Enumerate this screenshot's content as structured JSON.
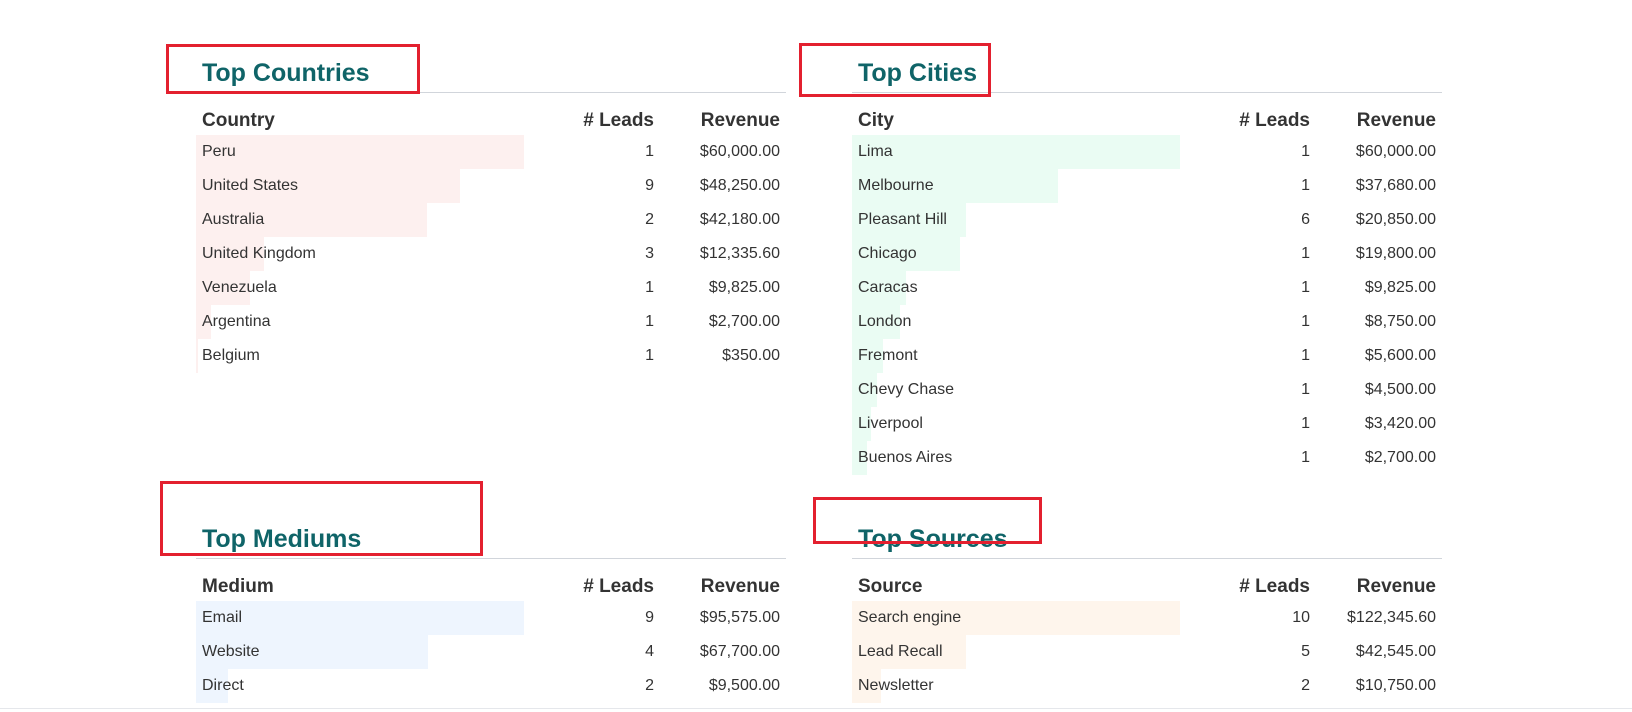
{
  "sections": [
    {
      "id": "countries",
      "title": "Top Countries",
      "headers": [
        "Country",
        "# Leads",
        "Revenue"
      ],
      "bar_color": "#fdf0ef",
      "rows": [
        {
          "label": "Peru",
          "leads": "1",
          "revenue": "$60,000.00",
          "share": 1.0
        },
        {
          "label": "United States",
          "leads": "9",
          "revenue": "$48,250.00",
          "share": 0.804
        },
        {
          "label": "Australia",
          "leads": "2",
          "revenue": "$42,180.00",
          "share": 0.703
        },
        {
          "label": "United Kingdom",
          "leads": "3",
          "revenue": "$12,335.60",
          "share": 0.206
        },
        {
          "label": "Venezuela",
          "leads": "1",
          "revenue": "$9,825.00",
          "share": 0.164
        },
        {
          "label": "Argentina",
          "leads": "1",
          "revenue": "$2,700.00",
          "share": 0.045
        },
        {
          "label": "Belgium",
          "leads": "1",
          "revenue": "$350.00",
          "share": 0.006
        }
      ]
    },
    {
      "id": "cities",
      "title": "Top Cities",
      "headers": [
        "City",
        "# Leads",
        "Revenue"
      ],
      "bar_color": "#eafcf3",
      "rows": [
        {
          "label": "Lima",
          "leads": "1",
          "revenue": "$60,000.00",
          "share": 1.0
        },
        {
          "label": "Melbourne",
          "leads": "1",
          "revenue": "$37,680.00",
          "share": 0.628
        },
        {
          "label": "Pleasant Hill",
          "leads": "6",
          "revenue": "$20,850.00",
          "share": 0.348
        },
        {
          "label": "Chicago",
          "leads": "1",
          "revenue": "$19,800.00",
          "share": 0.33
        },
        {
          "label": "Caracas",
          "leads": "1",
          "revenue": "$9,825.00",
          "share": 0.164
        },
        {
          "label": "London",
          "leads": "1",
          "revenue": "$8,750.00",
          "share": 0.146
        },
        {
          "label": "Fremont",
          "leads": "1",
          "revenue": "$5,600.00",
          "share": 0.093
        },
        {
          "label": "Chevy Chase",
          "leads": "1",
          "revenue": "$4,500.00",
          "share": 0.075
        },
        {
          "label": "Liverpool",
          "leads": "1",
          "revenue": "$3,420.00",
          "share": 0.057
        },
        {
          "label": "Buenos Aires",
          "leads": "1",
          "revenue": "$2,700.00",
          "share": 0.045
        }
      ]
    },
    {
      "id": "mediums",
      "title": "Top Mediums",
      "headers": [
        "Medium",
        "# Leads",
        "Revenue"
      ],
      "bar_color": "#eef5fe",
      "rows": [
        {
          "label": "Email",
          "leads": "9",
          "revenue": "$95,575.00",
          "share": 1.0
        },
        {
          "label": "Website",
          "leads": "4",
          "revenue": "$67,700.00",
          "share": 0.708
        },
        {
          "label": "Direct",
          "leads": "2",
          "revenue": "$9,500.00",
          "share": 0.099
        }
      ]
    },
    {
      "id": "sources",
      "title": "Top Sources",
      "headers": [
        "Source",
        "# Leads",
        "Revenue"
      ],
      "bar_color": "#fef5ec",
      "rows": [
        {
          "label": "Search engine",
          "leads": "10",
          "revenue": "$122,345.60",
          "share": 1.0
        },
        {
          "label": "Lead Recall",
          "leads": "5",
          "revenue": "$42,545.00",
          "share": 0.348
        },
        {
          "label": "Newsletter",
          "leads": "2",
          "revenue": "$10,750.00",
          "share": 0.088
        }
      ]
    }
  ]
}
